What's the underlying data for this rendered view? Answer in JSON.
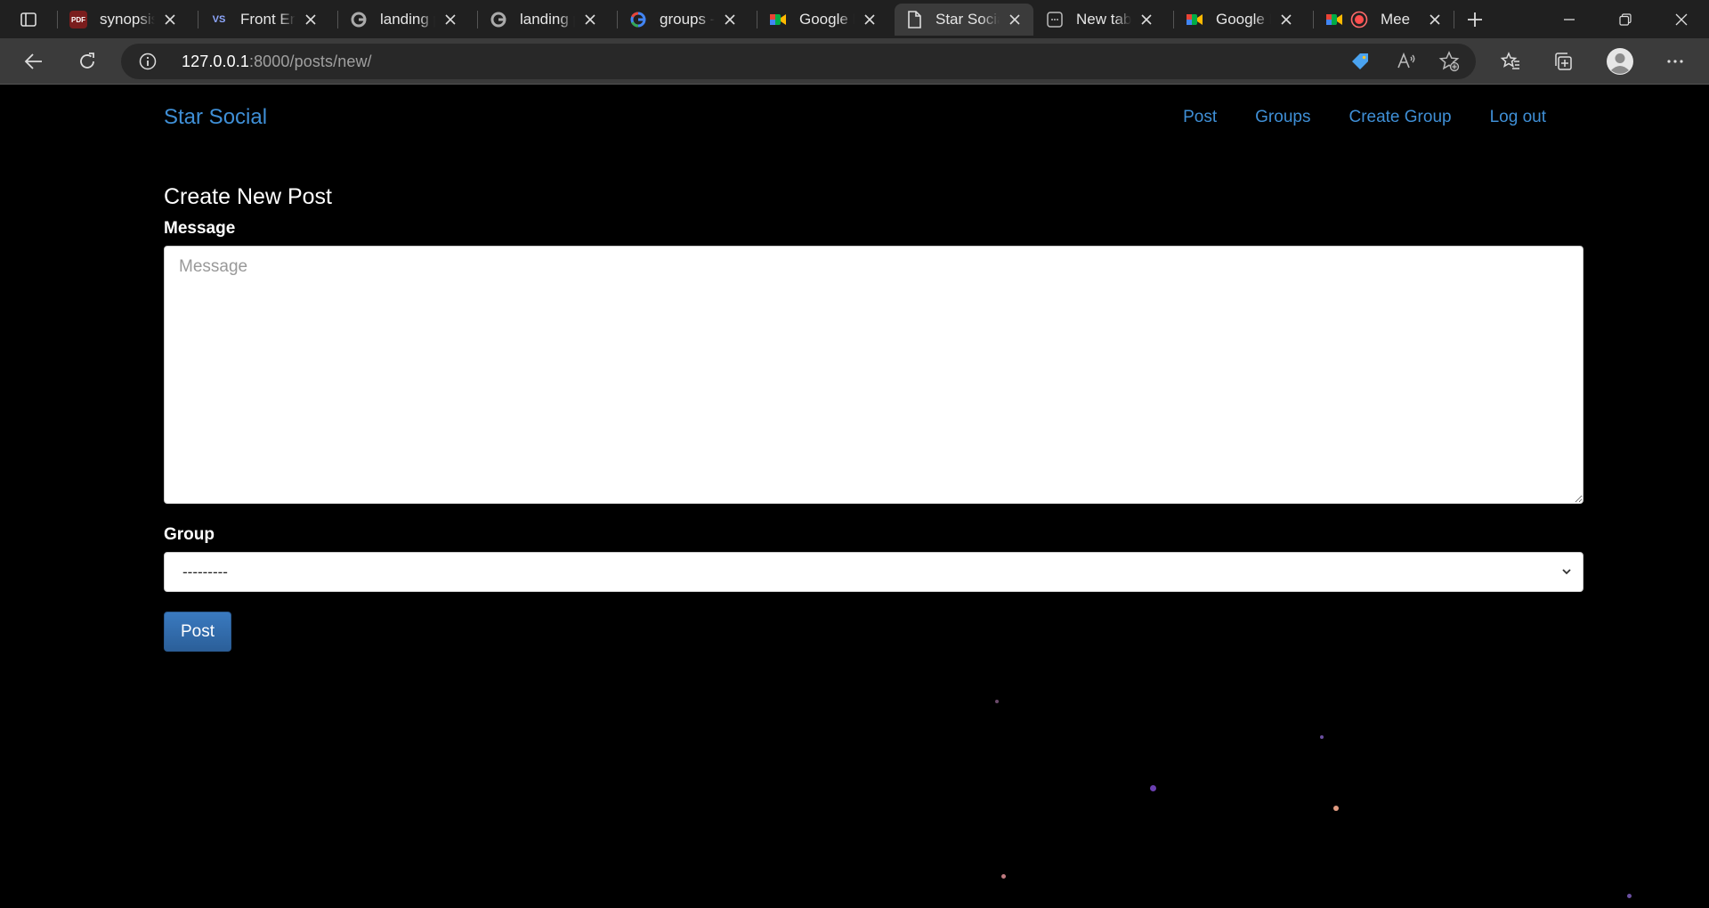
{
  "browser": {
    "tabs": [
      {
        "title": "synopsis_",
        "favicon": "pdf-icon",
        "active": false
      },
      {
        "title": "Front End",
        "favicon": "vs-icon",
        "active": false
      },
      {
        "title": "landing p",
        "favicon": "google-icon",
        "active": false
      },
      {
        "title": "landing p",
        "favicon": "google-icon",
        "active": false
      },
      {
        "title": "groups - ",
        "favicon": "google-icon",
        "active": false
      },
      {
        "title": "Google M",
        "favicon": "meet-icon",
        "active": false
      },
      {
        "title": "Star Socia",
        "favicon": "page-icon",
        "active": true
      },
      {
        "title": "New tab",
        "favicon": "newtab-icon",
        "active": false
      },
      {
        "title": "Google M",
        "favicon": "meet-icon",
        "active": false
      },
      {
        "title": "Mee",
        "favicon": "record-icon",
        "active": false
      }
    ],
    "address": {
      "host": "127.0.0.1",
      "rest": ":8000/posts/new/"
    }
  },
  "nav": {
    "brand": "Star Social",
    "links": {
      "post": "Post",
      "groups": "Groups",
      "create_group": "Create Group",
      "logout": "Log out"
    }
  },
  "form": {
    "title": "Create New Post",
    "message_label": "Message",
    "message_placeholder": "Message",
    "group_label": "Group",
    "group_selected": "---------",
    "submit_label": "Post"
  },
  "colors": {
    "accent": "#3f8fd6",
    "button": "#2b5f99",
    "background": "#000000"
  }
}
